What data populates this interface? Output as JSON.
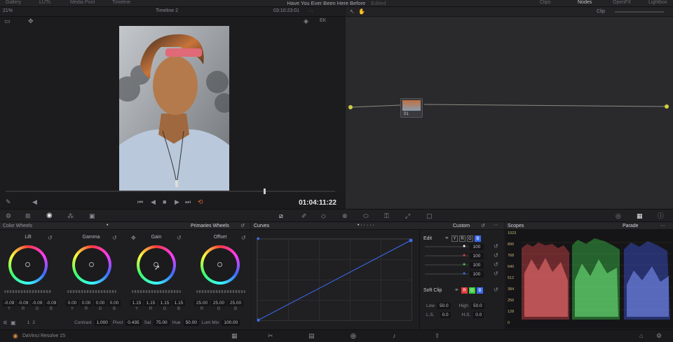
{
  "app": {
    "window_title": "Have You Ever Been Here Before",
    "edited_flag": "Edited",
    "name": "DaVinci Resolve 15"
  },
  "top_tabs": {
    "left": [
      "Gallery",
      "LUTs",
      "Media Pool",
      "Timeline"
    ],
    "right": [
      "Clips",
      "Nodes",
      "OpenFX",
      "Lightbox"
    ]
  },
  "viewer": {
    "zoom": "21%",
    "timeline_name": "Timeline 2",
    "header_timecode": "03:10:23:01",
    "timecode": "01:04:11:22"
  },
  "node_editor": {
    "mode": "Clip",
    "node_label": "01"
  },
  "color_wheels": {
    "title": "Color Wheels",
    "mode": "Primaries Wheels",
    "wheels": [
      {
        "name": "Lift",
        "values": [
          "-0.09",
          "-0.09",
          "-0.09",
          "-0.09"
        ],
        "labels": [
          "Y",
          "R",
          "G",
          "B"
        ]
      },
      {
        "name": "Gamma",
        "values": [
          "0.00",
          "0.00",
          "0.00",
          "0.00"
        ],
        "labels": [
          "Y",
          "R",
          "G",
          "B"
        ]
      },
      {
        "name": "Gain",
        "values": [
          "1.15",
          "1.15",
          "1.15",
          "1.15"
        ],
        "labels": [
          "Y",
          "R",
          "G",
          "B"
        ]
      },
      {
        "name": "Offset",
        "values": [
          "25.00",
          "25.00",
          "25.00"
        ],
        "labels": [
          "R",
          "G",
          "B"
        ]
      }
    ],
    "bottom": {
      "page_a": "1",
      "page_b": "2",
      "contrast_label": "Contrast",
      "contrast": "1.000",
      "pivot_label": "Pivot",
      "pivot": "0.435",
      "sat_label": "Sat",
      "sat": "75.00",
      "hue_label": "Hue",
      "hue": "50.00",
      "lummix_label": "Lum Mix",
      "lummix": "100.00"
    }
  },
  "curves": {
    "title": "Curves",
    "mode": "Custom",
    "edit_label": "Edit",
    "channels": [
      "Y",
      "R",
      "G",
      "B"
    ],
    "intensities": [
      "100",
      "100",
      "100",
      "100"
    ],
    "channel_colors": [
      "#ffffff",
      "#e03c3c",
      "#3ccf3c",
      "#3c6cf0"
    ],
    "softclip_label": "Soft Clip",
    "softclip": {
      "low_label": "Low",
      "low": "50.0",
      "high_label": "High",
      "high": "50.0",
      "ls_label": "L.S.",
      "ls": "0.0",
      "hs_label": "H.S.",
      "hs": "0.0"
    }
  },
  "scopes": {
    "title": "Scopes",
    "mode": "Parade",
    "scale": [
      "1023",
      "896",
      "768",
      "640",
      "512",
      "384",
      "256",
      "128",
      "0"
    ]
  },
  "colors": {
    "accent": "#3c6cf0",
    "bg": "#1e1e21",
    "panel_head": "#262629"
  }
}
